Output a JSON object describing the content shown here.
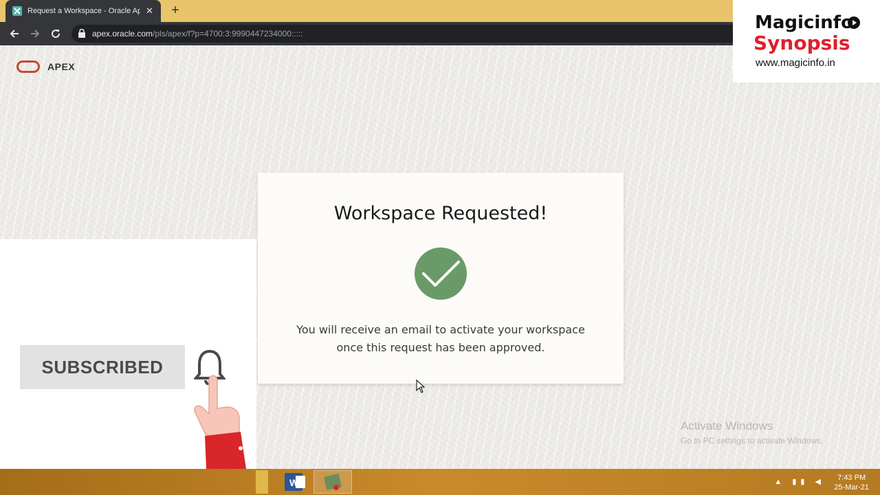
{
  "browser": {
    "tab_title": "Request a Workspace - Oracle Ap",
    "close_glyph": "✕",
    "new_tab_glyph": "+",
    "url_host": "apex.oracle.com",
    "url_path": "/pls/apex/f?p=4700:3:9990447234000:::::"
  },
  "page": {
    "brand": "APEX",
    "card": {
      "title": "Workspace Requested!",
      "message_line1": "You will receive an email to activate your workspace",
      "message_line2": "once this request has been approved."
    },
    "activate_windows": {
      "title": "Activate Windows",
      "subtitle": "Go to PC settings to activate Windows."
    }
  },
  "overlay": {
    "subscribed_label": "SUBSCRIBED"
  },
  "watermark": {
    "line1": "Magicinfo",
    "line2": "Synopsis",
    "url": "www.magicinfo.in"
  },
  "taskbar": {
    "time": "7:43 PM",
    "date": "25-Mar-21"
  },
  "colors": {
    "tab_strip": "#e9c46a",
    "oracle_red": "#c74634",
    "check_green": "#6a9a68",
    "brand_red": "#e0202b"
  }
}
